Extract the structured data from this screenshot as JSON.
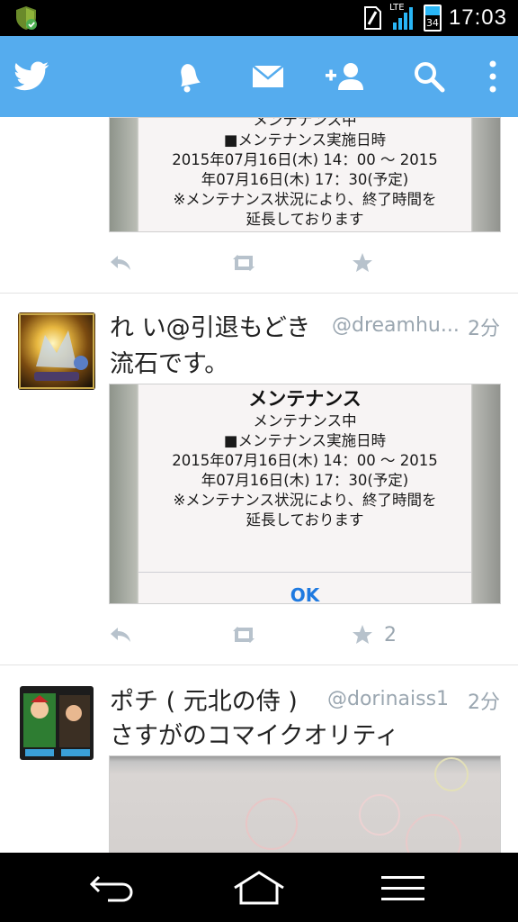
{
  "status_bar": {
    "time": "17:03",
    "network": "LTE",
    "battery": "34",
    "icons": [
      "shield-check-icon",
      "sim-icon",
      "signal-icon",
      "battery-icon"
    ]
  },
  "app_bar": {
    "color": "#55acee",
    "icons": [
      "twitter-bird-icon",
      "notifications-bell-icon",
      "messages-envelope-icon",
      "add-user-icon",
      "search-icon",
      "overflow-menu-icon"
    ]
  },
  "tweets": [
    {
      "media_lines": [
        "メンテナンス中",
        "■メンテナンス実施日時",
        "2015年07月16日(木) 14：00 ～ 2015",
        "年07月16日(木) 17：30(予定)",
        "※メンテナンス状況により、終了時間を",
        "延長しております"
      ],
      "actions": {
        "reply_icon": "reply-icon",
        "retweet_icon": "retweet-icon",
        "favorite_icon": "star-icon"
      }
    },
    {
      "name": "れ い@引退もどき",
      "handle": "@dreamhu...",
      "time": "2分",
      "text": "流石です。",
      "media_title": "メンテナンス",
      "media_lines": [
        "メンテナンス中",
        "■メンテナンス実施日時",
        "2015年07月16日(木) 14：00 ～ 2015",
        "年07月16日(木) 17：30(予定)",
        "※メンテナンス状況により、終了時間を",
        "延長しております"
      ],
      "media_button": "OK",
      "favorite_count": "2"
    },
    {
      "name": "ポチ ( 元北の侍 )",
      "handle": "@dorinaiss1",
      "time": "2分",
      "text": "さすがのコマイクオリティ"
    }
  ],
  "nav_bar": {
    "icons": [
      "back-icon",
      "home-icon",
      "recent-apps-icon"
    ]
  }
}
